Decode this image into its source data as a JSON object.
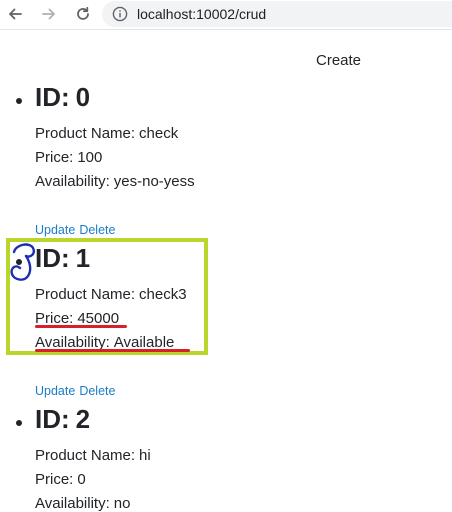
{
  "browser": {
    "url": "localhost:10002/crud",
    "icons": [
      "back-arrow-icon",
      "forward-arrow-icon",
      "reload-icon",
      "info-icon"
    ]
  },
  "page": {
    "create_label": "Create",
    "id_label": "ID:",
    "name_label": "Product Name:",
    "price_label": "Price:",
    "availability_label": "Availability:",
    "update_label": "Update",
    "delete_label": "Delete"
  },
  "products": [
    {
      "id": "0",
      "name": "check",
      "price": "100",
      "availability": "yes-no-yess"
    },
    {
      "id": "1",
      "name": "check3",
      "price": "45000",
      "availability": "Available"
    },
    {
      "id": "2",
      "name": "hi",
      "price": "0",
      "availability": "no"
    }
  ],
  "annotation": {
    "highlight_color": "#b8d62b",
    "underline_color": "#d9202a",
    "scribble_color": "#1a2fb0"
  }
}
